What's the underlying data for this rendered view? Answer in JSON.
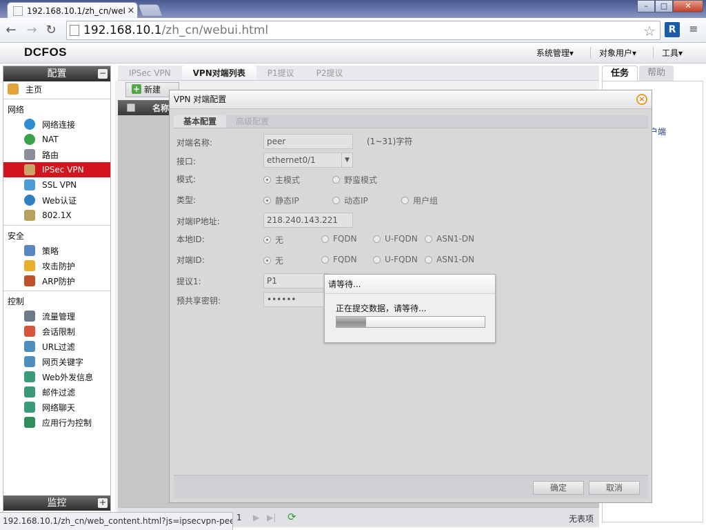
{
  "browser": {
    "tab_title": "192.168.10.1/zh_cn/web",
    "tab_close": "×",
    "url_host": "192.168.10.1",
    "url_path": "/zh_cn/webui.html",
    "back": "←",
    "forward": "→",
    "reload": "↻",
    "star": "☆",
    "ext_label": "R",
    "menu": "≡",
    "win_min": "–",
    "win_max": "□",
    "win_close": "✕"
  },
  "app": {
    "logo": "DCFOS",
    "top_menu": [
      "系统管理▾",
      "对象用户▾",
      "工具▾"
    ]
  },
  "sidebar": {
    "config_title": "配置",
    "config_toggle": "−",
    "home": "主页",
    "sections": [
      {
        "title": "网络",
        "items": [
          "网络连接",
          "NAT",
          "路由",
          "IPSec VPN",
          "SSL VPN",
          "Web认证",
          "802.1X"
        ]
      },
      {
        "title": "安全",
        "items": [
          "策略",
          "攻击防护",
          "ARP防护"
        ]
      },
      {
        "title": "控制",
        "items": [
          "流量管理",
          "会话限制",
          "URL过滤",
          "网页关键字",
          "Web外发信息",
          "邮件过滤",
          "网络聊天",
          "应用行为控制"
        ]
      }
    ],
    "active_item": "IPSec VPN",
    "monitor_title": "监控",
    "monitor_toggle": "+"
  },
  "main": {
    "tabs": [
      "IPSec VPN",
      "VPN对端列表",
      "P1提议",
      "P2提议"
    ],
    "active_tab": "VPN对端列表",
    "new_button": "新建",
    "grid_header": "名称",
    "pager_page": "1",
    "pager_last": "▶|",
    "pager_next": "▶",
    "refresh": "⟳",
    "no_records": "无表项"
  },
  "right_panel": {
    "tabs": [
      "任务",
      "帮助"
    ],
    "link_fragment": "户端"
  },
  "dialog": {
    "title": "VPN 对端配置",
    "close": "×",
    "tabs": [
      "基本配置",
      "高级配置"
    ],
    "fields": {
      "peer_name_label": "对端名称:",
      "peer_name_value": "peer",
      "peer_name_hint": "(1~31)字符",
      "interface_label": "接口:",
      "interface_value": "ethernet0/1",
      "mode_label": "模式:",
      "mode_options": [
        "主模式",
        "野蛮模式"
      ],
      "type_label": "类型:",
      "type_options": [
        "静态IP",
        "动态IP",
        "用户组"
      ],
      "peer_ip_label": "对端IP地址:",
      "peer_ip_value": "218.240.143.221",
      "local_id_label": "本地ID:",
      "id_options": [
        "无",
        "FQDN",
        "U-FQDN",
        "ASN1-DN"
      ],
      "peer_id_label": "对端ID:",
      "proposal1_label": "提议1:",
      "proposal1_value": "P1",
      "psk_label": "预共享密钥:",
      "psk_value": "••••••"
    },
    "ok_button": "确定",
    "cancel_button": "取消"
  },
  "wait_dialog": {
    "title": "请等待...",
    "message": "正在提交数据，请等待...",
    "progress": 0.2
  },
  "status_bar": {
    "url": "192.168.10.1/zh_cn/web_content.html?js=ipsecvpn-peer..."
  },
  "colors": {
    "active_nav": "#d2141e",
    "sidebar_header": "#3a3a3a",
    "dialog_close": "#e07a12"
  }
}
